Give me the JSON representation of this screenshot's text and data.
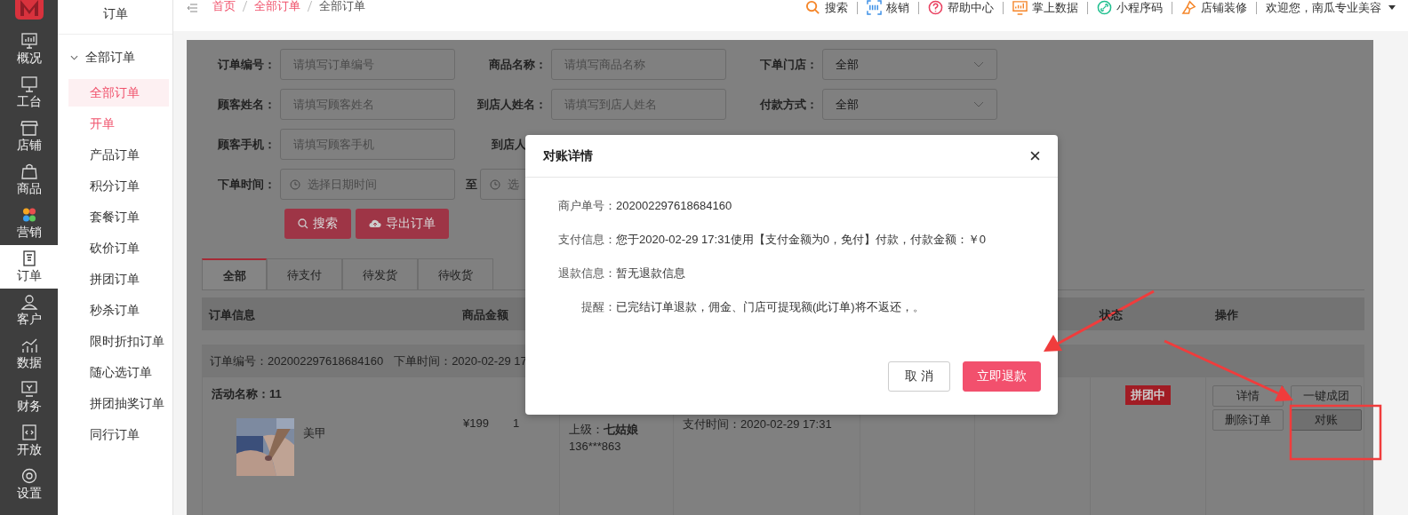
{
  "nav": [
    {
      "label": "概况",
      "kind": "overview",
      "selected": false
    },
    {
      "label": "工台",
      "kind": "desk",
      "selected": false
    },
    {
      "label": "店铺",
      "kind": "store",
      "selected": false
    },
    {
      "label": "商品",
      "kind": "goods",
      "selected": false
    },
    {
      "label": "营销",
      "kind": "marketing",
      "selected": false
    },
    {
      "label": "订单",
      "kind": "order",
      "selected": true
    },
    {
      "label": "客户",
      "kind": "customer",
      "selected": false
    },
    {
      "label": "数据",
      "kind": "data",
      "selected": false
    },
    {
      "label": "财务",
      "kind": "finance",
      "selected": false
    },
    {
      "label": "开放",
      "kind": "open",
      "selected": false
    },
    {
      "label": "设置",
      "kind": "settings",
      "selected": false
    }
  ],
  "subnav": {
    "title": "订单",
    "group": {
      "label": "全部订单",
      "expanded": true,
      "children": [
        {
          "label": "全部订单",
          "selected": true,
          "highlighted": false
        },
        {
          "label": "开单",
          "selected": false,
          "highlighted": true
        },
        {
          "label": "产品订单",
          "selected": false,
          "highlighted": false
        },
        {
          "label": "积分订单",
          "selected": false,
          "highlighted": false
        },
        {
          "label": "套餐订单",
          "selected": false,
          "highlighted": false
        },
        {
          "label": "砍价订单",
          "selected": false,
          "highlighted": false
        },
        {
          "label": "拼团订单",
          "selected": false,
          "highlighted": false
        },
        {
          "label": "秒杀订单",
          "selected": false,
          "highlighted": false
        },
        {
          "label": "限时折扣订单",
          "selected": false,
          "highlighted": false
        },
        {
          "label": "随心选订单",
          "selected": false,
          "highlighted": false
        },
        {
          "label": "拼团抽奖订单",
          "selected": false,
          "highlighted": false
        },
        {
          "label": "同行订单",
          "selected": false,
          "highlighted": false
        }
      ]
    }
  },
  "breadcrumb": [
    {
      "label": "首页",
      "link": true
    },
    {
      "label": "全部订单",
      "link": true
    },
    {
      "label": "全部订单",
      "link": false
    }
  ],
  "top_links": [
    {
      "label": "搜索",
      "kind": "search"
    },
    {
      "label": "核销",
      "kind": "scan"
    },
    {
      "label": "帮助中心",
      "kind": "help"
    },
    {
      "label": "掌上数据",
      "kind": "chart"
    },
    {
      "label": "小程序码",
      "kind": "link"
    },
    {
      "label": "店铺装修",
      "kind": "brush"
    }
  ],
  "user": "欢迎您，南瓜专业美容",
  "filters": [
    [
      {
        "kind": "text",
        "label": "订单编号：",
        "placeholder": "请填写订单编号"
      },
      {
        "kind": "text",
        "label": "商品名称：",
        "placeholder": "请填写商品名称"
      },
      {
        "kind": "select",
        "label": "下单门店：",
        "value": "全部"
      }
    ],
    [
      {
        "kind": "text",
        "label": "顾客姓名：",
        "placeholder": "请填写顾客姓名"
      },
      {
        "kind": "text",
        "label": "到店人姓名：",
        "placeholder": "请填写到店人姓名"
      },
      {
        "kind": "select",
        "label": "付款方式：",
        "value": "全部"
      }
    ],
    [
      {
        "kind": "text",
        "label": "顾客手机：",
        "placeholder": "请填写顾客手机"
      },
      {
        "kind": "label_only",
        "label": "到店人"
      }
    ]
  ],
  "date_range": {
    "label": "下单时间：",
    "start_placeholder": "选择日期时间",
    "separator": "至",
    "end_placeholder": "选"
  },
  "actions": [
    {
      "label": "搜索",
      "kind": "search"
    },
    {
      "label": "导出订单",
      "kind": "export"
    }
  ],
  "tabs": [
    {
      "label": "全部",
      "selected": true
    },
    {
      "label": "待支付",
      "selected": false
    },
    {
      "label": "待发货",
      "selected": false
    },
    {
      "label": "待收货",
      "selected": false
    }
  ],
  "table": {
    "columns": [
      "订单信息",
      "商品金额",
      "状态",
      "操作"
    ]
  },
  "order": {
    "number": "订单编号：202002297618684160",
    "time": "下单时间：2020-02-29 17",
    "activity": "活动名称：11",
    "product": {
      "name": "美甲",
      "price": "¥199",
      "quantity": "1"
    },
    "referrer": "上级：**七姑娘**",
    "phone": "136***863",
    "pay_time": "支付时间：2020-02-29 17:31",
    "status": "拼团中",
    "buttons": [
      {
        "label": "详情",
        "selected": false
      },
      {
        "label": "一键成团",
        "selected": false
      },
      {
        "label": "删除订单",
        "selected": false
      },
      {
        "label": "对账",
        "selected": true
      }
    ]
  },
  "dialog": {
    "title": "对账详情",
    "rows": [
      {
        "label": "商户单号：",
        "value": "202002297618684160"
      },
      {
        "label": "支付信息：",
        "value": "您于2020-02-29 17:31使用【支付金额为0，免付】付款，付款金额：￥0"
      },
      {
        "label": "退款信息：",
        "value": "暂无退款信息"
      },
      {
        "label": "提醒：",
        "value": "已完结订单退款，佣金、门店可提现额(此订单)将不返还，。"
      }
    ],
    "buttons": [
      {
        "label": "取 消",
        "kind": "secondary"
      },
      {
        "label": "立即退款",
        "kind": "primary"
      }
    ]
  }
}
